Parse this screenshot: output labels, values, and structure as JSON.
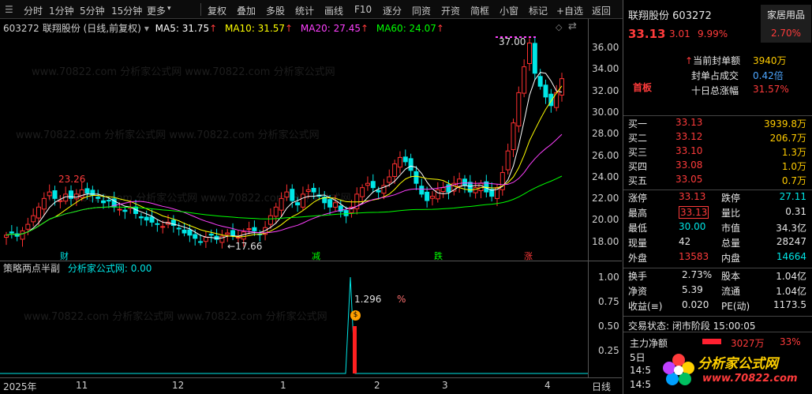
{
  "toolbar": {
    "items": [
      "分时",
      "1分钟",
      "5分钟",
      "15分钟",
      "更多",
      "复权",
      "叠加",
      "多股",
      "统计",
      "画线",
      "F10",
      "逐分",
      "同资",
      "开资",
      "简框",
      "小窗",
      "标记",
      "+自选",
      "返回"
    ]
  },
  "chart": {
    "code": "603272",
    "title": "联翔股份 (日线,前复权)",
    "ma5": "MA5: 31.75",
    "ma10": "MA10: 31.57",
    "ma20": "MA20: 27.45",
    "ma60": "MA60: 24.07",
    "high_label": "37.00",
    "low_label": "17.66",
    "label_2326": "23.26",
    "y_ticks": [
      "36.00",
      "34.00",
      "32.00",
      "30.00",
      "28.00",
      "26.00",
      "24.00",
      "22.00",
      "20.00",
      "18.00"
    ],
    "markers": [
      "财",
      "减",
      "跌",
      "涨"
    ],
    "colors": {
      "up": "#ff3030",
      "down": "#00e6e6",
      "ma5": "#ffffff",
      "ma10": "#ffff00",
      "ma20": "#ff40ff",
      "ma60": "#00ff00"
    }
  },
  "indicator": {
    "title": "策略两点半副",
    "subtitle": "分析家公式网: 0.00",
    "value_label": "1.296",
    "pct": "%",
    "y_ticks": [
      "1.00",
      "0.75",
      "0.50",
      "0.25"
    ]
  },
  "xaxis": {
    "labels": [
      "2025年",
      "11",
      "12",
      "1",
      "2",
      "3",
      "4",
      "日线"
    ]
  },
  "quote": {
    "name": "联翔股份",
    "code": "603272",
    "sector": "家居用品",
    "sector_pct": "2.70%",
    "price": "33.13",
    "change": "3.01",
    "change_pct": "9.99%",
    "seal_label": "当前封单额",
    "seal_value": "3940万",
    "seal_ratio_label": "封单占成交",
    "seal_ratio": "0.42倍",
    "ten_day_label": "十日总涨幅",
    "ten_day": "31.57%",
    "tag": "首板",
    "bids": [
      {
        "label": "买一",
        "price": "33.13",
        "vol": "3939.8万"
      },
      {
        "label": "买二",
        "price": "33.12",
        "vol": "206.7万"
      },
      {
        "label": "买三",
        "price": "33.10",
        "vol": "1.3万"
      },
      {
        "label": "买四",
        "price": "33.08",
        "vol": "1.0万"
      },
      {
        "label": "买五",
        "price": "33.05",
        "vol": "0.7万"
      }
    ],
    "stats": [
      {
        "l1": "涨停",
        "v1": "33.13",
        "l2": "跌停",
        "v2": "27.11"
      },
      {
        "l1": "最高",
        "v1": "33.13",
        "l2": "量比",
        "v2": "0.31"
      },
      {
        "l1": "最低",
        "v1": "30.00",
        "l2": "市值",
        "v2": "34.3亿"
      },
      {
        "l1": "现量",
        "v1": "42",
        "l2": "总量",
        "v2": "28247"
      },
      {
        "l1": "外盘",
        "v1": "13583",
        "l2": "内盘",
        "v2": "14664"
      }
    ],
    "stats2": [
      {
        "l1": "换手",
        "v1": "2.73%",
        "l2": "股本",
        "v2": "1.04亿"
      },
      {
        "l1": "净资",
        "v1": "5.39",
        "l2": "流通",
        "v2": "1.04亿"
      },
      {
        "l1": "收益(≡)",
        "v1": "0.020",
        "l2": "PE(动)",
        "v2": "1173.5"
      }
    ],
    "trade_state": "交易状态: 闭市阶段 15:00:05",
    "main_flow_label": "主力净额",
    "main_flow_value": "3027万",
    "main_flow_pct": "33%",
    "small1": "5日",
    "small2": "14:5",
    "small3": "14:5"
  },
  "watermark": {
    "text": "www.70822.com 分析家公式网",
    "logo_text": "分析家公式网",
    "logo_url": "www.70822.com"
  }
}
